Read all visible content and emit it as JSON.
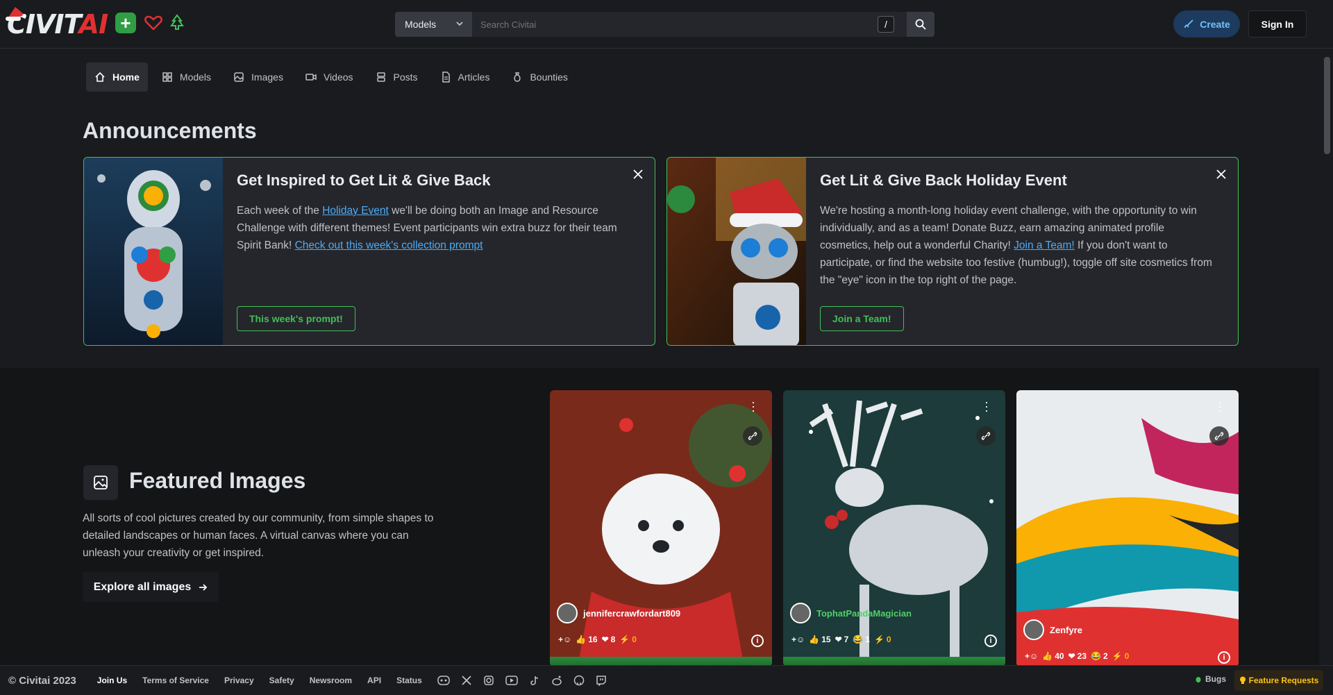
{
  "header": {
    "logo_prefix": "CIVIT",
    "logo_suffix": "AI",
    "search_type": "Models",
    "search_placeholder": "Search Civitai",
    "slash_key": "/",
    "create_label": "Create",
    "signin_label": "Sign In"
  },
  "nav": [
    {
      "label": "Home",
      "icon": "home-icon",
      "active": true
    },
    {
      "label": "Models",
      "icon": "grid-icon"
    },
    {
      "label": "Images",
      "icon": "image-icon"
    },
    {
      "label": "Videos",
      "icon": "video-icon"
    },
    {
      "label": "Posts",
      "icon": "posts-icon"
    },
    {
      "label": "Articles",
      "icon": "article-icon"
    },
    {
      "label": "Bounties",
      "icon": "moneybag-icon"
    }
  ],
  "announcements": {
    "title": "Announcements",
    "cards": [
      {
        "title": "Get Inspired to Get Lit & Give Back",
        "text_1": "Each week of the ",
        "link_1": "Holiday Event",
        "text_2": " we'll be doing both an Image and Resource Challenge with different themes! Event participants win extra buzz for their team Spirit Bank! ",
        "link_2": "Check out this week's collection prompt",
        "button": "This week's prompt!"
      },
      {
        "title": "Get Lit & Give Back Holiday Event",
        "text_1": "We're hosting a month-long holiday event challenge, with the opportunity to win individually, and as a team! Donate Buzz, earn amazing animated profile cosmetics, help out a wonderful Charity! ",
        "link_1": "Join a Team!",
        "text_2": " If you don't want to participate, or find the website too festive (humbug!), toggle off site cosmetics from the \"eye\" icon in the top right of the page.",
        "button": "Join a Team!"
      }
    ]
  },
  "featured": {
    "title": "Featured Images",
    "description": "All sorts of cool pictures created by our community, from simple shapes to detailed landscapes or human faces. A virtual canvas where you can unleash your creativity or get inspired.",
    "explore_label": "Explore all images",
    "cards": [
      {
        "user": "jennifercrawfordart809",
        "likes": "16",
        "hearts": "8",
        "laughs": "",
        "buzz": "0"
      },
      {
        "user": "TophatPandaMagician",
        "likes": "15",
        "hearts": "7",
        "laughs": "1",
        "buzz": "0"
      },
      {
        "user": "Zenfyre",
        "likes": "40",
        "hearts": "23",
        "laughs": "2",
        "buzz": "0"
      }
    ]
  },
  "footer": {
    "copyright": "© Civitai 2023",
    "links": [
      "Join Us",
      "Terms of Service",
      "Privacy",
      "Safety",
      "Newsroom",
      "API",
      "Status"
    ],
    "social_icons": [
      "discord-icon",
      "x-icon",
      "instagram-icon",
      "youtube-icon",
      "tiktok-icon",
      "reddit-icon",
      "github-icon",
      "twitch-icon"
    ],
    "bugs_label": "Bugs",
    "feature_requests_label": "Feature Requests"
  },
  "colors": {
    "accent_green": "#40c057",
    "link_blue": "#4dabf7",
    "brand_red": "#e03131"
  }
}
